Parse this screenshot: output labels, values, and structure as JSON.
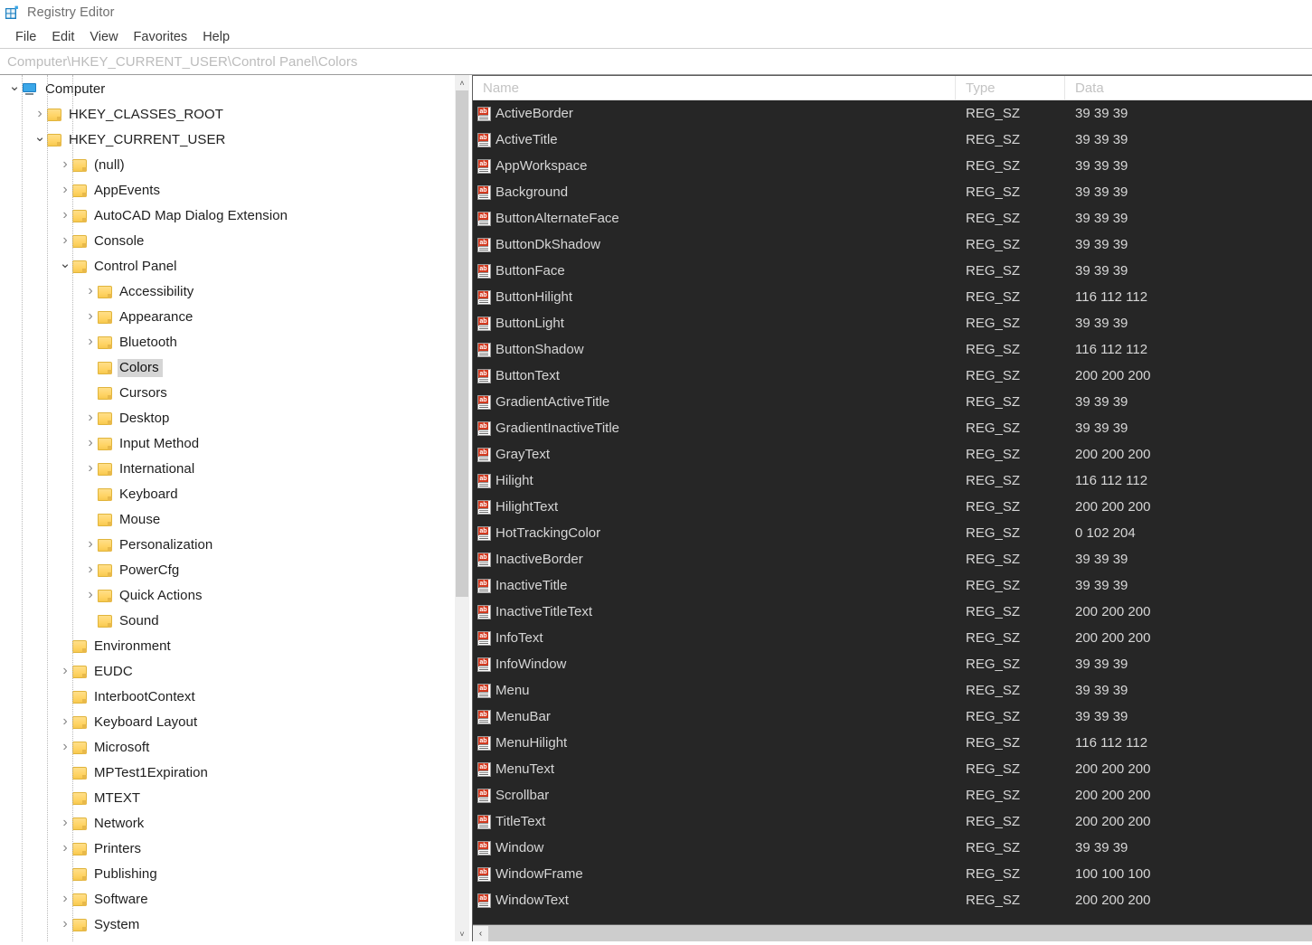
{
  "window": {
    "title": "Registry Editor",
    "icon": "registry-editor-icon"
  },
  "menubar": {
    "items": [
      {
        "label": "File"
      },
      {
        "label": "Edit"
      },
      {
        "label": "View"
      },
      {
        "label": "Favorites"
      },
      {
        "label": "Help"
      }
    ]
  },
  "address": {
    "value": "Computer\\HKEY_CURRENT_USER\\Control Panel\\Colors"
  },
  "tree": {
    "scroll_up_arrow": "˄",
    "scroll_down_arrow": "˅",
    "items": [
      {
        "label": "Computer",
        "depth": 0,
        "state": "expanded",
        "icon": "computer-icon",
        "selected": false
      },
      {
        "label": "HKEY_CLASSES_ROOT",
        "depth": 1,
        "state": "collapsed",
        "icon": "folder-icon",
        "selected": false
      },
      {
        "label": "HKEY_CURRENT_USER",
        "depth": 1,
        "state": "expanded",
        "icon": "folder-icon",
        "selected": false
      },
      {
        "label": "(null)",
        "depth": 2,
        "state": "collapsed",
        "icon": "folder-icon",
        "selected": false
      },
      {
        "label": "AppEvents",
        "depth": 2,
        "state": "collapsed",
        "icon": "folder-icon",
        "selected": false
      },
      {
        "label": "AutoCAD Map Dialog Extension",
        "depth": 2,
        "state": "collapsed",
        "icon": "folder-icon",
        "selected": false
      },
      {
        "label": "Console",
        "depth": 2,
        "state": "collapsed",
        "icon": "folder-icon",
        "selected": false
      },
      {
        "label": "Control Panel",
        "depth": 2,
        "state": "expanded",
        "icon": "folder-icon",
        "selected": false
      },
      {
        "label": "Accessibility",
        "depth": 3,
        "state": "collapsed",
        "icon": "folder-icon",
        "selected": false
      },
      {
        "label": "Appearance",
        "depth": 3,
        "state": "collapsed",
        "icon": "folder-icon",
        "selected": false
      },
      {
        "label": "Bluetooth",
        "depth": 3,
        "state": "collapsed",
        "icon": "folder-icon",
        "selected": false
      },
      {
        "label": "Colors",
        "depth": 3,
        "state": "leaf",
        "icon": "folder-icon",
        "selected": true
      },
      {
        "label": "Cursors",
        "depth": 3,
        "state": "leaf",
        "icon": "folder-icon",
        "selected": false
      },
      {
        "label": "Desktop",
        "depth": 3,
        "state": "collapsed",
        "icon": "folder-icon",
        "selected": false
      },
      {
        "label": "Input Method",
        "depth": 3,
        "state": "collapsed",
        "icon": "folder-icon",
        "selected": false
      },
      {
        "label": "International",
        "depth": 3,
        "state": "collapsed",
        "icon": "folder-icon",
        "selected": false
      },
      {
        "label": "Keyboard",
        "depth": 3,
        "state": "leaf",
        "icon": "folder-icon",
        "selected": false
      },
      {
        "label": "Mouse",
        "depth": 3,
        "state": "leaf",
        "icon": "folder-icon",
        "selected": false
      },
      {
        "label": "Personalization",
        "depth": 3,
        "state": "collapsed",
        "icon": "folder-icon",
        "selected": false
      },
      {
        "label": "PowerCfg",
        "depth": 3,
        "state": "collapsed",
        "icon": "folder-icon",
        "selected": false
      },
      {
        "label": "Quick Actions",
        "depth": 3,
        "state": "collapsed",
        "icon": "folder-icon",
        "selected": false
      },
      {
        "label": "Sound",
        "depth": 3,
        "state": "leaf",
        "icon": "folder-icon",
        "selected": false
      },
      {
        "label": "Environment",
        "depth": 2,
        "state": "leaf",
        "icon": "folder-icon",
        "selected": false
      },
      {
        "label": "EUDC",
        "depth": 2,
        "state": "collapsed",
        "icon": "folder-icon",
        "selected": false
      },
      {
        "label": "InterbootContext",
        "depth": 2,
        "state": "leaf",
        "icon": "folder-icon",
        "selected": false
      },
      {
        "label": "Keyboard Layout",
        "depth": 2,
        "state": "collapsed",
        "icon": "folder-icon",
        "selected": false
      },
      {
        "label": "Microsoft",
        "depth": 2,
        "state": "collapsed",
        "icon": "folder-icon",
        "selected": false
      },
      {
        "label": "MPTest1Expiration",
        "depth": 2,
        "state": "leaf",
        "icon": "folder-icon",
        "selected": false
      },
      {
        "label": "MTEXT",
        "depth": 2,
        "state": "leaf",
        "icon": "folder-icon",
        "selected": false
      },
      {
        "label": "Network",
        "depth": 2,
        "state": "collapsed",
        "icon": "folder-icon",
        "selected": false
      },
      {
        "label": "Printers",
        "depth": 2,
        "state": "collapsed",
        "icon": "folder-icon",
        "selected": false
      },
      {
        "label": "Publishing",
        "depth": 2,
        "state": "leaf",
        "icon": "folder-icon",
        "selected": false
      },
      {
        "label": "Software",
        "depth": 2,
        "state": "collapsed",
        "icon": "folder-icon",
        "selected": false
      },
      {
        "label": "System",
        "depth": 2,
        "state": "collapsed",
        "icon": "folder-icon",
        "selected": false
      }
    ]
  },
  "list": {
    "columns": [
      {
        "label": "Name"
      },
      {
        "label": "Type"
      },
      {
        "label": "Data"
      }
    ],
    "scroll_left_arrow": "‹",
    "rows": [
      {
        "name": "ActiveBorder",
        "type": "REG_SZ",
        "data": "39 39 39"
      },
      {
        "name": "ActiveTitle",
        "type": "REG_SZ",
        "data": "39 39 39"
      },
      {
        "name": "AppWorkspace",
        "type": "REG_SZ",
        "data": "39 39 39"
      },
      {
        "name": "Background",
        "type": "REG_SZ",
        "data": "39 39 39"
      },
      {
        "name": "ButtonAlternateFace",
        "type": "REG_SZ",
        "data": "39 39 39"
      },
      {
        "name": "ButtonDkShadow",
        "type": "REG_SZ",
        "data": "39 39 39"
      },
      {
        "name": "ButtonFace",
        "type": "REG_SZ",
        "data": "39 39 39"
      },
      {
        "name": "ButtonHilight",
        "type": "REG_SZ",
        "data": "116 112 112"
      },
      {
        "name": "ButtonLight",
        "type": "REG_SZ",
        "data": "39 39 39"
      },
      {
        "name": "ButtonShadow",
        "type": "REG_SZ",
        "data": "116 112 112"
      },
      {
        "name": "ButtonText",
        "type": "REG_SZ",
        "data": "200 200 200"
      },
      {
        "name": "GradientActiveTitle",
        "type": "REG_SZ",
        "data": "39 39 39"
      },
      {
        "name": "GradientInactiveTitle",
        "type": "REG_SZ",
        "data": "39 39 39"
      },
      {
        "name": "GrayText",
        "type": "REG_SZ",
        "data": "200 200 200"
      },
      {
        "name": "Hilight",
        "type": "REG_SZ",
        "data": "116 112 112"
      },
      {
        "name": "HilightText",
        "type": "REG_SZ",
        "data": "200 200 200"
      },
      {
        "name": "HotTrackingColor",
        "type": "REG_SZ",
        "data": "0 102 204"
      },
      {
        "name": "InactiveBorder",
        "type": "REG_SZ",
        "data": "39 39 39"
      },
      {
        "name": "InactiveTitle",
        "type": "REG_SZ",
        "data": "39 39 39"
      },
      {
        "name": "InactiveTitleText",
        "type": "REG_SZ",
        "data": "200 200 200"
      },
      {
        "name": "InfoText",
        "type": "REG_SZ",
        "data": "200 200 200"
      },
      {
        "name": "InfoWindow",
        "type": "REG_SZ",
        "data": "39 39 39"
      },
      {
        "name": "Menu",
        "type": "REG_SZ",
        "data": "39 39 39"
      },
      {
        "name": "MenuBar",
        "type": "REG_SZ",
        "data": "39 39 39"
      },
      {
        "name": "MenuHilight",
        "type": "REG_SZ",
        "data": "116 112 112"
      },
      {
        "name": "MenuText",
        "type": "REG_SZ",
        "data": "200 200 200"
      },
      {
        "name": "Scrollbar",
        "type": "REG_SZ",
        "data": "200 200 200"
      },
      {
        "name": "TitleText",
        "type": "REG_SZ",
        "data": "200 200 200"
      },
      {
        "name": "Window",
        "type": "REG_SZ",
        "data": "39 39 39"
      },
      {
        "name": "WindowFrame",
        "type": "REG_SZ",
        "data": "100 100 100"
      },
      {
        "name": "WindowText",
        "type": "REG_SZ",
        "data": "200 200 200"
      }
    ]
  },
  "colors": {
    "list_background": "#262626",
    "list_text": "#d6d6d6",
    "header_background": "#ffffff",
    "header_text": "#c3c3c3",
    "tree_background": "#ffffff",
    "tree_text": "#1f1f1f",
    "selection_background": "#d5d5d5",
    "folder_accent": "#ffd466",
    "string_icon_accent": "#d33a20",
    "titlebar_text": "#6f6f6f"
  }
}
